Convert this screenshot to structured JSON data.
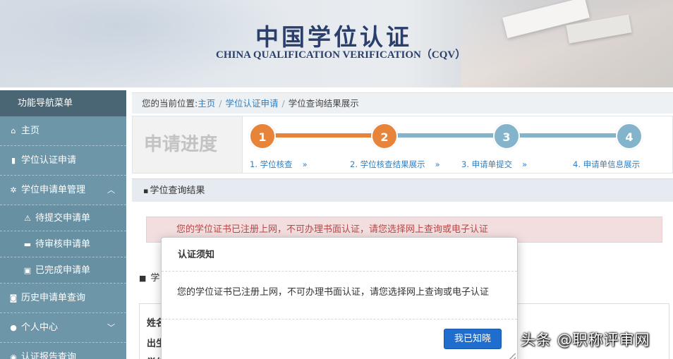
{
  "banner": {
    "title_cn": "中国学位认证",
    "title_en": "CHINA QUALIFICATION VERIFICATION（CQV）"
  },
  "sidebar": {
    "header": "功能导航菜单",
    "items": [
      {
        "label": "主页",
        "icon": "home-icon"
      },
      {
        "label": "学位认证申请",
        "icon": "file-icon"
      },
      {
        "label": "学位申请单管理",
        "icon": "gear-icon"
      },
      {
        "label": "待提交申请单",
        "icon": "warning-icon"
      },
      {
        "label": "待审核申请单",
        "icon": "cart-icon"
      },
      {
        "label": "已完成申请单",
        "icon": "briefcase-icon"
      },
      {
        "label": "历史申请单查询",
        "icon": "camera-icon"
      },
      {
        "label": "个人中心",
        "icon": "user-icon"
      },
      {
        "label": "认证报告查询",
        "icon": "search-icon"
      }
    ]
  },
  "breadcrumb": {
    "prefix": "您的当前位置:",
    "items": [
      "主页",
      "学位认证申请",
      "学位查询结果展示"
    ]
  },
  "progress": {
    "title": "申请进度",
    "steps": [
      {
        "num": "1",
        "label": "1. 学位核查",
        "arrow": "»"
      },
      {
        "num": "2",
        "label": "2. 学位核查结果展示",
        "arrow": "»"
      },
      {
        "num": "3",
        "label": "3. 申请单提交",
        "arrow": "»"
      },
      {
        "num": "4",
        "label": "4. 申请单信息展示"
      }
    ],
    "colors": {
      "done": "#e8833a",
      "todo": "#83b4cb"
    }
  },
  "section": {
    "title": "学位查询结果",
    "alert": "您的学位证书已注册上网，不可办理书面认证，请您选择网上查询或电子认证",
    "sub_title": "学",
    "labels": [
      "姓名",
      "出生",
      "学位"
    ]
  },
  "modal": {
    "title": "认证须知",
    "message": "您的学位证书已注册上网，不可办理书面认证，请您选择网上查询或电子认证",
    "button": "我已知晓"
  },
  "watermark": "头条 @职称评审网"
}
